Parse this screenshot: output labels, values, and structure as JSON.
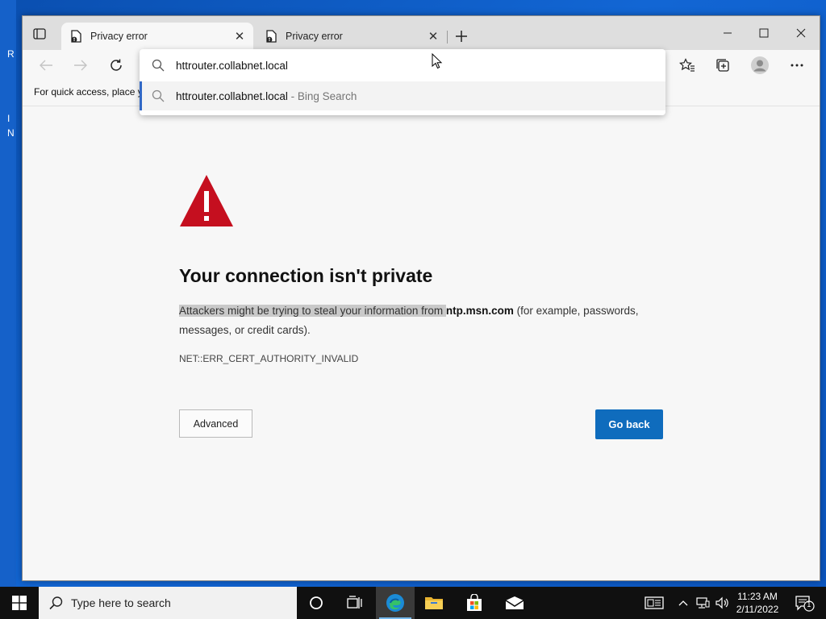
{
  "desktop": {
    "fragments": [
      "R",
      "I",
      "N"
    ]
  },
  "browser": {
    "tabs": [
      {
        "title": "Privacy error",
        "active": true
      },
      {
        "title": "Privacy error",
        "active": false
      }
    ],
    "address": {
      "input_value": "httrouter.collabnet.local",
      "suggestion_text": "httrouter.collabnet.local",
      "suggestion_suffix": " - Bing Search"
    },
    "favorites_bar_text": "For quick access, place y"
  },
  "page": {
    "heading": "Your connection isn't private",
    "desc_highlight": "Attackers might be trying to steal your information from ",
    "desc_domain": "ntp.msn.com",
    "desc_rest": " (for example, passwords, messages, or credit cards).",
    "error_code": "NET::ERR_CERT_AUTHORITY_INVALID",
    "advanced_label": "Advanced",
    "go_back_label": "Go back"
  },
  "taskbar": {
    "search_placeholder": "Type here to search",
    "time": "11:23 AM",
    "date": "2/11/2022",
    "notification_count": "1"
  },
  "colors": {
    "warning_red": "#c50f1f",
    "primary_blue": "#0f6cbd",
    "selection_accent": "#3168c6"
  }
}
